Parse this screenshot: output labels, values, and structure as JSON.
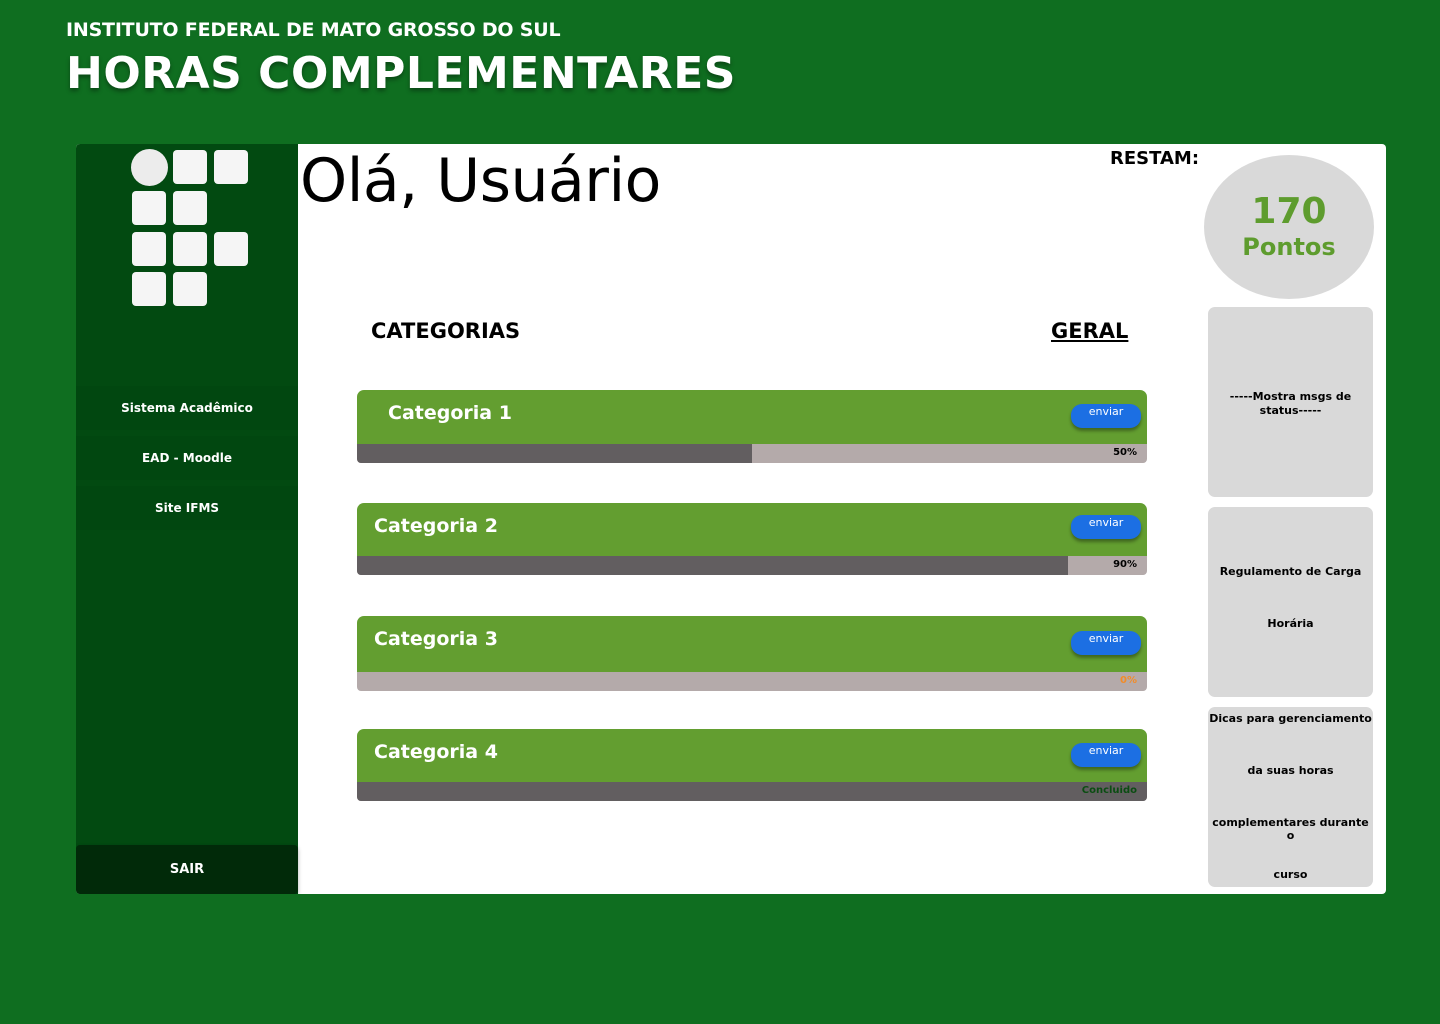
{
  "header": {
    "institute": "INSTITUTO FEDERAL DE MATO GROSSO DO SUL",
    "app_title": "HORAS COMPLEMENTARES"
  },
  "sidebar": {
    "logo_icon": "ifms-logo-icon",
    "items": [
      {
        "label": "Sistema Acadêmico"
      },
      {
        "label": "EAD - Moodle"
      },
      {
        "label": "Site IFMS"
      }
    ],
    "logout_label": "SAIR"
  },
  "main": {
    "greeting": "Olá, Usuário",
    "categories_label": "CATEGORIAS",
    "general_label": "GERAL",
    "categories": [
      {
        "name": "Categoria 1",
        "send_label": "enviar",
        "progress": 0.5,
        "progress_text": "50%",
        "text_color": "#000000"
      },
      {
        "name": "Categoria 2",
        "send_label": "enviar",
        "progress": 0.9,
        "progress_text": "90%",
        "text_color": "#000000"
      },
      {
        "name": "Categoria 3",
        "send_label": "enviar",
        "progress": 0.0,
        "progress_text": "0%",
        "text_color": "#f28c28"
      },
      {
        "name": "Categoria 4",
        "send_label": "enviar",
        "progress": 1.0,
        "progress_text": "Concluido",
        "text_color": "#0b4d12"
      }
    ]
  },
  "status": {
    "remaining_label": "RESTAM:",
    "points_value": "170",
    "points_unit": "Pontos",
    "messages": "-----Mostra msgs de status-----",
    "regulation_line1": "Regulamento de Carga",
    "regulation_line2": "Horária",
    "tips_line1": "Dicas para gerenciamento",
    "tips_line2": "da suas horas",
    "tips_line3": "complementares durante o",
    "tips_line4": "curso"
  },
  "colors": {
    "background": "#0f6e20",
    "sidebar": "#024a11",
    "category_header": "#639e30",
    "button": "#1c6fe3",
    "bar_fill": "#625e60",
    "bar_track": "#b4aaaa"
  }
}
